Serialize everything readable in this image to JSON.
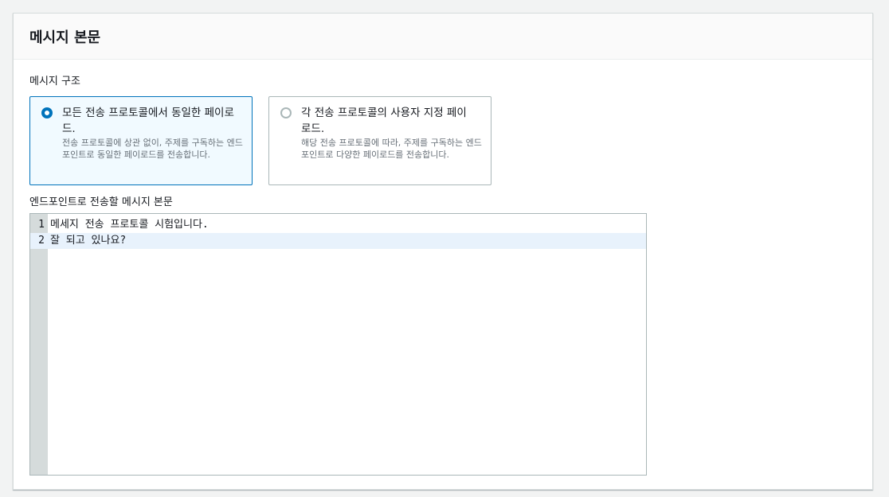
{
  "panel": {
    "title": "메시지 본문"
  },
  "structure": {
    "label": "메시지 구조",
    "options": [
      {
        "title": "모든 전송 프로토콜에서 동일한 페이로드.",
        "description": "전송 프로토콜에 상관 없이, 주제를 구독하는 엔드포인트로 동일한 페이로드를 전송합니다.",
        "selected": true
      },
      {
        "title": "각 전송 프로토콜의 사용자 지정 페이로드.",
        "description": "해당 전송 프로토콜에 따라, 주제를 구독하는 엔드포인트로 다양한 페이로드를 전송합니다.",
        "selected": false
      }
    ]
  },
  "body": {
    "label": "엔드포인트로 전송할 메시지 본문",
    "lines": [
      {
        "number": "1",
        "text": "메세지 전송 프로토콜 시험입니다."
      },
      {
        "number": "2",
        "text": "잘 되고 있나요?"
      }
    ]
  },
  "colors": {
    "accent": "#0073bb",
    "selected_tile_bg": "#f1faff",
    "active_line_bg": "#e8f2fc",
    "gutter_bg": "#d5dbdb"
  }
}
